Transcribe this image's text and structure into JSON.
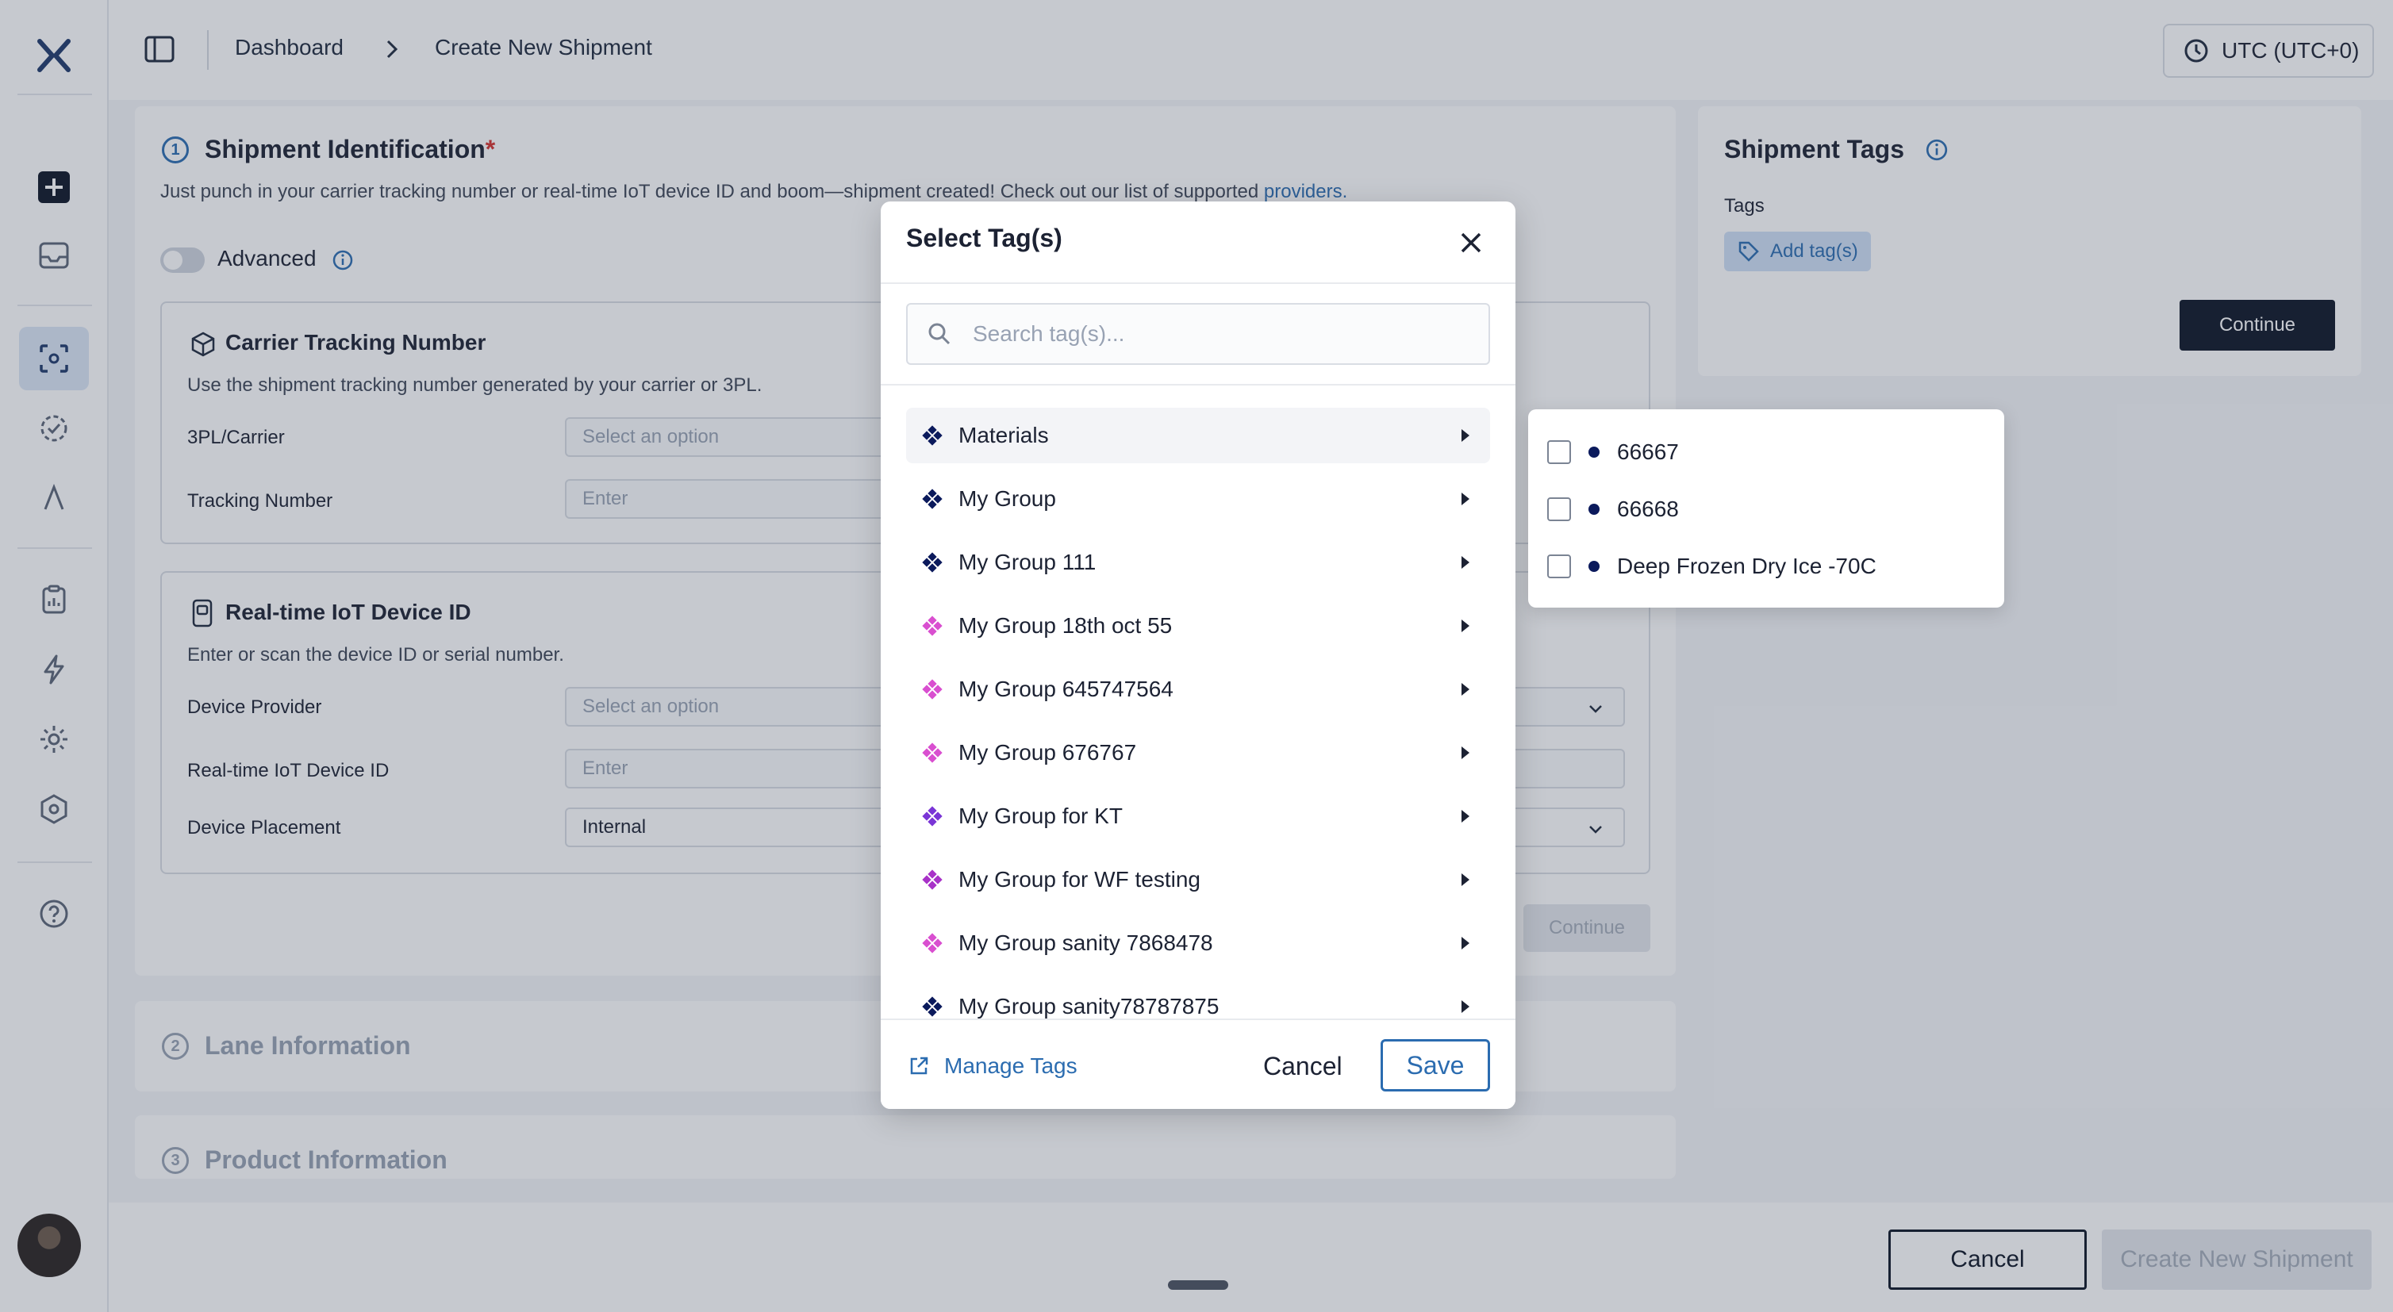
{
  "header": {
    "breadcrumbs": [
      "Dashboard",
      "Create New Shipment"
    ],
    "timezone": "UTC (UTC+0)"
  },
  "identification": {
    "step": "1",
    "title": "Shipment Identification",
    "required_mark": "*",
    "description": "Just punch in your carrier tracking number or real-time IoT device ID and boom—shipment created! Check out our list of supported ",
    "description_link": "providers.",
    "advanced_label": "Advanced",
    "carrier": {
      "title": "Carrier Tracking Number",
      "description": "Use the shipment tracking number generated by your carrier or 3PL.",
      "carrier_label": "3PL/Carrier",
      "carrier_placeholder": "Select an option",
      "tracking_label": "Tracking Number",
      "tracking_placeholder": "Enter"
    },
    "iot": {
      "title": "Real-time IoT Device ID",
      "description": "Enter or scan the device ID or serial number.",
      "provider_label": "Device Provider",
      "provider_placeholder": "Select an option",
      "device_label": "Real-time IoT Device ID",
      "device_placeholder": "Enter",
      "placement_label": "Device Placement",
      "placement_value": "Internal"
    },
    "continue_label": "Continue"
  },
  "tags_card": {
    "title": "Shipment Tags",
    "tags_label": "Tags",
    "add_tag_label": "Add tag(s)",
    "continue_label": "Continue"
  },
  "lane": {
    "step": "2",
    "title": "Lane Information"
  },
  "product": {
    "step": "3",
    "title": "Product Information"
  },
  "footer": {
    "cancel_label": "Cancel",
    "create_label": "Create New Shipment"
  },
  "modal": {
    "title": "Select Tag(s)",
    "search_placeholder": "Search tag(s)...",
    "items": [
      {
        "label": "Materials",
        "color": "#0b1a5c"
      },
      {
        "label": "My Group",
        "color": "#0b1a5c"
      },
      {
        "label": "My Group 111",
        "color": "#0b1a5c"
      },
      {
        "label": "My Group 18th oct 55",
        "color": "#d94fd0"
      },
      {
        "label": "My Group 645747564",
        "color": "#d94fd0"
      },
      {
        "label": "My Group 676767",
        "color": "#d94fd0"
      },
      {
        "label": "My Group for KT",
        "color": "#7a35d6"
      },
      {
        "label": "My Group for WF testing",
        "color": "#a832c8"
      },
      {
        "label": "My Group sanity 7868478",
        "color": "#d94fd0"
      },
      {
        "label": "My Group sanity78787875",
        "color": "#0b1a5c"
      }
    ],
    "manage_label": "Manage Tags",
    "cancel_label": "Cancel",
    "save_label": "Save"
  },
  "submenu": {
    "items": [
      {
        "label": "66667",
        "color": "#0b1a5c"
      },
      {
        "label": "66668",
        "color": "#0b1a5c"
      },
      {
        "label": "Deep Frozen Dry Ice -70C",
        "color": "#0b1a5c"
      }
    ]
  }
}
